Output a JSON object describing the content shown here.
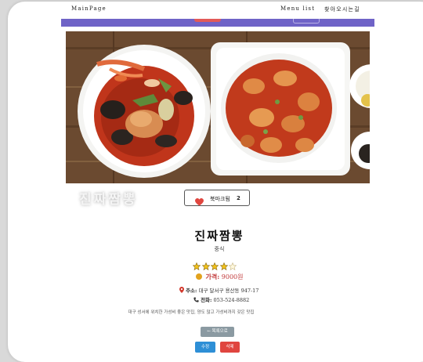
{
  "nav": {
    "brand": "MainPage",
    "menu_list": "Menu list",
    "directions": "찾아오시는길"
  },
  "restaurant": {
    "overlay_title": "진짜짬뽕",
    "name": "진짜짬뽕",
    "category": "중식",
    "rating": 4,
    "rating_max": 5,
    "price_label": "가격:",
    "price_value": "9000원",
    "address_label": "주소:",
    "address_value": "대구 달서구 용산동 947-17",
    "phone_label": "전화:",
    "phone_value": "053-524-8882",
    "description": "대구 성서에 위치한 가성비 좋은 맛집, 양도 많고 가성비까지 갖은 맛집"
  },
  "bookmark": {
    "label": "북마크됨",
    "count": "2"
  },
  "buttons": {
    "back": "← 목록으로",
    "edit": "수정",
    "delete": "삭제"
  },
  "colors": {
    "accent_bar": "#6f63c7",
    "price": "#c23b3b",
    "edit": "#2e8fd6",
    "delete": "#e0453f",
    "back": "#8b9aa2"
  }
}
